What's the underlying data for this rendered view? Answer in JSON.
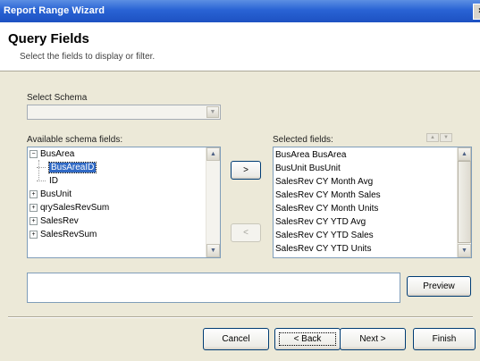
{
  "window": {
    "title": "Report Range Wizard",
    "close_glyph": "×"
  },
  "header": {
    "title": "Query Fields",
    "subtitle": "Select the fields to display or filter."
  },
  "schema": {
    "label": "Select Schema",
    "value": ""
  },
  "available": {
    "label": "Available schema fields:",
    "items": [
      {
        "label": "BusArea",
        "expander": "−"
      },
      {
        "label": "BusAreaID",
        "expander": ""
      },
      {
        "label": "ID",
        "expander": ""
      },
      {
        "label": "BusUnit",
        "expander": "+"
      },
      {
        "label": "qrySalesRevSum",
        "expander": "+"
      },
      {
        "label": "SalesRev",
        "expander": "+"
      },
      {
        "label": "SalesRevSum",
        "expander": "+"
      }
    ]
  },
  "transfer": {
    "add_label": ">",
    "remove_label": "<"
  },
  "selected": {
    "label": "Selected fields:",
    "items": [
      "BusArea BusArea",
      "BusUnit BusUnit",
      "SalesRev CY Month Avg",
      "SalesRev CY Month Sales",
      "SalesRev CY Month Units",
      "SalesRev CY YTD Avg",
      "SalesRev CY YTD Sales",
      "SalesRev CY YTD Units"
    ]
  },
  "order": {
    "up_glyph": "▲",
    "down_glyph": "▼"
  },
  "preview": {
    "label": "Preview"
  },
  "footer": {
    "cancel": "Cancel",
    "back": "< Back",
    "next": "Next >",
    "finish": "Finish"
  },
  "scroll": {
    "up_glyph": "▲",
    "down_glyph": "▼"
  },
  "colors": {
    "title_bar": "#2963d4",
    "selection": "#316ac5",
    "dialog_bg": "#ece9d8"
  }
}
